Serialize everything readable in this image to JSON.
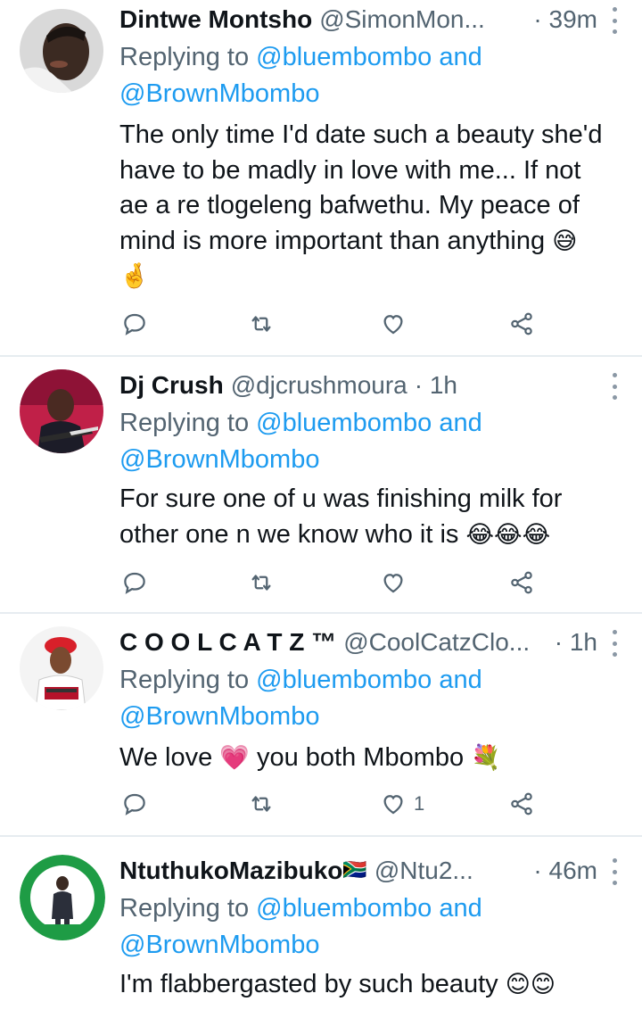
{
  "tweets": [
    {
      "name": "Dintwe Montsho",
      "handle": "@SimonMon...",
      "time": "· 39m",
      "replying_prefix": "Replying to ",
      "reply_to_1": "@bluembombo",
      "reply_and": " and",
      "reply_to_2": "@BrownMbombo",
      "text_lines": [
        "The only time I'd date such a beauty she'd",
        "have to be madly in love with me... If not",
        "ae a re tlogeleng bafwethu. My peace of",
        "mind is more important than anything"
      ],
      "emoji_1": "😅",
      "emoji_2": "🤞",
      "like_count": ""
    },
    {
      "name": "Dj Crush",
      "handle": "@djcrushmoura",
      "time": "· 1h",
      "replying_prefix": "Replying to ",
      "reply_to_1": "@bluembombo",
      "reply_and": " and",
      "reply_to_2": "@BrownMbombo",
      "text_lines": [
        "For sure one of u was finishing milk for",
        "other one n we know who it is"
      ],
      "emoji_1": "😂😂😂",
      "like_count": ""
    },
    {
      "name": "C O O L C A T Z ™",
      "handle": "@CoolCatzClo...",
      "time": "· 1h",
      "replying_prefix": "Replying to ",
      "reply_to_1": "@bluembombo",
      "reply_and": " and",
      "reply_to_2": "@BrownMbombo",
      "text_before": "We love ",
      "emoji_1": "💗",
      "text_after": " you both Mbombo ",
      "emoji_2": "💐",
      "like_count": "1"
    },
    {
      "name": "NtuthukoMazibuko",
      "name_flag": "🇿🇦",
      "handle": "@Ntu2...",
      "time": "· 46m",
      "replying_prefix": "Replying to ",
      "reply_to_1": "@bluembombo",
      "reply_and": " and",
      "reply_to_2": "@BrownMbombo",
      "text_before": "I'm flabbergasted by such beauty ",
      "emoji_1": "😊😊"
    }
  ],
  "icons": {
    "reply": "reply-icon",
    "retweet": "retweet-icon",
    "like": "heart-icon",
    "share": "share-icon",
    "more": "more-icon"
  },
  "colors": {
    "link": "#1d9bf0",
    "secondary_text": "#536471",
    "primary_text": "#0f1419",
    "divider": "#e6ecf0"
  }
}
